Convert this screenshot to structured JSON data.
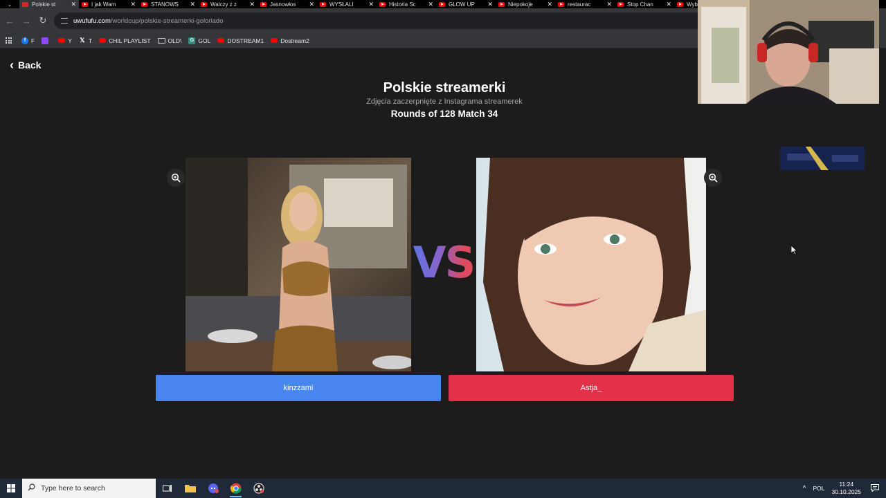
{
  "browser": {
    "tabs": [
      {
        "title": "Polskie st",
        "favicon": "uwufufu-icon",
        "active": true
      },
      {
        "title": "I jak Wam",
        "favicon": "youtube-icon"
      },
      {
        "title": "STANOWS",
        "favicon": "youtube-icon"
      },
      {
        "title": "Walczy z z",
        "favicon": "youtube-icon"
      },
      {
        "title": "Jasnowłos",
        "favicon": "youtube-icon"
      },
      {
        "title": "WYSŁALI",
        "favicon": "youtube-icon"
      },
      {
        "title": "Historia Sc",
        "favicon": "youtube-icon"
      },
      {
        "title": "GLOW UP",
        "favicon": "youtube-icon"
      },
      {
        "title": "Niepokoje",
        "favicon": "youtube-icon"
      },
      {
        "title": "restaurac",
        "favicon": "youtube-icon"
      },
      {
        "title": "Stop Chan",
        "favicon": "youtube-icon"
      },
      {
        "title": "Wybi",
        "favicon": "youtube-icon"
      }
    ],
    "url_host": "uwufufu.com",
    "url_path": "/worldcup/polskie-streamerki-goloriado",
    "bookmarks": [
      {
        "label": "F",
        "icon": "facebook-icon"
      },
      {
        "label": "",
        "icon": "twitch-icon"
      },
      {
        "label": "Y",
        "icon": "youtube-icon"
      },
      {
        "label": "T",
        "icon": "x-icon"
      },
      {
        "label": "CHIL PLAYLIST",
        "icon": "youtube-icon"
      },
      {
        "label": "OLD\\",
        "icon": "folder-icon"
      },
      {
        "label": "GOL",
        "icon": "g-icon"
      },
      {
        "label": "DOSTREAM1",
        "icon": "youtube-icon"
      },
      {
        "label": "Dostream2",
        "icon": "youtube-icon"
      }
    ]
  },
  "page": {
    "back_label": "Back",
    "title": "Polskie streamerki",
    "subtitle": "Zdjęcia zaczerpnięte z Instagrama streamerek",
    "round_info": "Rounds of 128 Match 34",
    "vs_label": "VS",
    "left_choice": "kinzzami",
    "right_choice": "Astja_"
  },
  "taskbar": {
    "search_placeholder": "Type here to search",
    "language": "POL",
    "time": "11:24",
    "date": "30.10.2025"
  },
  "colors": {
    "left_button": "#4a86f0",
    "right_button": "#e3314a",
    "page_bg": "#1c1c1c"
  }
}
